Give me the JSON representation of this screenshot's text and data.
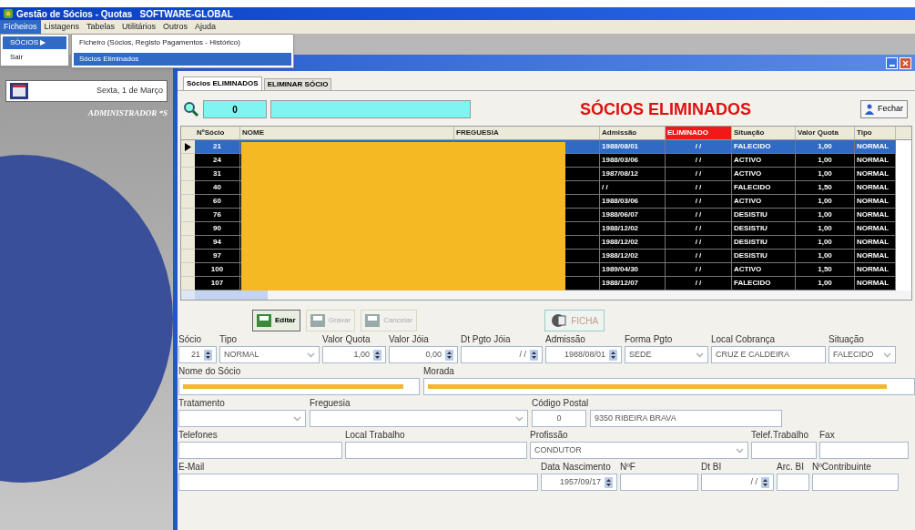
{
  "app": {
    "title": "Gestão de Sócios - Quotas   SOFTWARE-GLOBAL"
  },
  "menu_bar": [
    {
      "label": "Ficheiros",
      "selected": true
    },
    {
      "label": "Listagens",
      "selected": false
    },
    {
      "label": "Tabelas",
      "selected": false
    },
    {
      "label": "Utilitários",
      "selected": false
    },
    {
      "label": "Outros",
      "selected": false
    },
    {
      "label": "Ajuda",
      "selected": false
    }
  ],
  "open_menu": {
    "items": [
      {
        "label": "SÓCIOS",
        "arrow": "▶",
        "selected": true
      },
      {
        "label": "Sair",
        "selected": false
      }
    ],
    "submenu": [
      {
        "label": "Ficheiro (Sócios, Registo Pagamentos - Histórico)",
        "selected": false
      },
      {
        "label": "Sócios Eliminados",
        "selected": true
      }
    ]
  },
  "side_panel": {
    "date": "Sexta, 1 de Março",
    "user": "ADMINISTRADOR *S"
  },
  "form_window": {
    "tabs": [
      {
        "label": "Sócios ELIMINADOS",
        "selected": true
      },
      {
        "label": "ELIMINAR SÓCIO",
        "selected": false
      }
    ],
    "search": {
      "value": "0"
    },
    "heading": "SÓCIOS ELIMINADOS",
    "close_button": "Fechar",
    "table": {
      "columns": [
        {
          "label": "NºSócio",
          "highlight": false
        },
        {
          "label": "NOME",
          "highlight": false
        },
        {
          "label": "FREGUESIA",
          "highlight": false
        },
        {
          "label": "Admissão",
          "highlight": false
        },
        {
          "label": "ELIMINADO",
          "highlight": true
        },
        {
          "label": "Situação",
          "highlight": false
        },
        {
          "label": "Valor Quota",
          "highlight": false
        },
        {
          "label": "Tipo",
          "highlight": false
        }
      ],
      "rows": [
        {
          "number": "21",
          "admission": "1988/08/01",
          "eliminated": "/ /",
          "situation": "FALECIDO",
          "quota": "1,00",
          "type": "NORMAL",
          "selected": true
        },
        {
          "number": "24",
          "admission": "1988/03/06",
          "eliminated": "/ /",
          "situation": "ACTIVO",
          "quota": "1,00",
          "type": "NORMAL",
          "selected": false
        },
        {
          "number": "31",
          "admission": "1987/08/12",
          "eliminated": "/ /",
          "situation": "ACTIVO",
          "quota": "1,00",
          "type": "NORMAL",
          "selected": false
        },
        {
          "number": "40",
          "admission": "/ /",
          "eliminated": "/ /",
          "situation": "FALECIDO",
          "quota": "1,50",
          "type": "NORMAL",
          "selected": false
        },
        {
          "number": "60",
          "admission": "1988/03/06",
          "eliminated": "/ /",
          "situation": "ACTIVO",
          "quota": "1,00",
          "type": "NORMAL",
          "selected": false
        },
        {
          "number": "76",
          "admission": "1988/06/07",
          "eliminated": "/ /",
          "situation": "DESISTIU",
          "quota": "1,00",
          "type": "NORMAL",
          "selected": false
        },
        {
          "number": "90",
          "admission": "1988/12/02",
          "eliminated": "/ /",
          "situation": "DESISTIU",
          "quota": "1,00",
          "type": "NORMAL",
          "selected": false
        },
        {
          "number": "94",
          "admission": "1988/12/02",
          "eliminated": "/ /",
          "situation": "DESISTIU",
          "quota": "1,00",
          "type": "NORMAL",
          "selected": false
        },
        {
          "number": "97",
          "admission": "1988/12/02",
          "eliminated": "/ /",
          "situation": "DESISTIU",
          "quota": "1,00",
          "type": "NORMAL",
          "selected": false
        },
        {
          "number": "100",
          "admission": "1989/04/30",
          "eliminated": "/ /",
          "situation": "ACTIVO",
          "quota": "1,50",
          "type": "NORMAL",
          "selected": false
        },
        {
          "number": "107",
          "admission": "1988/12/07",
          "eliminated": "/ /",
          "situation": "FALECIDO",
          "quota": "1,00",
          "type": "NORMAL",
          "selected": false
        }
      ]
    },
    "actions": [
      {
        "label": "Editar",
        "disabled": false
      },
      {
        "label": "Gravar",
        "disabled": true
      },
      {
        "label": "Cancelar",
        "disabled": true
      }
    ],
    "ficha_button": "FICHA",
    "field_rows": [
      [
        {
          "label": "Sócio",
          "kind": "spin",
          "value": "21"
        },
        {
          "label": "Tipo",
          "kind": "select",
          "value": "NORMAL"
        },
        {
          "label": "Valor Quota",
          "kind": "spin",
          "value": "1,00"
        },
        {
          "label": "Valor Jóia",
          "kind": "spin",
          "value": "0,00"
        },
        {
          "label": "Dt Pgto Jóia",
          "kind": "spin",
          "value": "/ /"
        },
        {
          "label": "Admissão",
          "kind": "spin",
          "value": "1988/08/01"
        },
        {
          "label": "Forma Pgto",
          "kind": "select",
          "value": "SEDE"
        },
        {
          "label": "Local Cobrança",
          "kind": "text",
          "value": "CRUZ E CALDEIRA"
        },
        {
          "label": "Situação",
          "kind": "select",
          "value": "FALECIDO"
        }
      ],
      [
        {
          "label": "Nome do Sócio",
          "kind": "redacted"
        },
        {
          "label": "Morada",
          "kind": "redacted"
        }
      ],
      [
        {
          "label": "Tratamento",
          "kind": "select"
        },
        {
          "label": "Freguesia",
          "kind": "select"
        },
        {
          "label": "Código Postal",
          "kind": "postal",
          "values": [
            "0",
            "9350 RIBEIRA BRAVA"
          ]
        }
      ],
      [
        {
          "label": "Telefones",
          "kind": "text"
        },
        {
          "label": "Local Trabalho",
          "kind": "text"
        },
        {
          "label": "Profissão",
          "kind": "select",
          "value": "CONDUTOR"
        },
        {
          "label": "Telef.Trabalho",
          "kind": "text"
        },
        {
          "label": "Fax",
          "kind": "text"
        }
      ],
      [
        {
          "label": "E-Mail",
          "kind": "text"
        },
        {
          "label": "Data Nascimento",
          "kind": "spin",
          "value": "1957/09/17"
        },
        {
          "label": "NºF",
          "kind": "text"
        },
        {
          "label": "Dt BI",
          "kind": "spin",
          "value": "/ /"
        },
        {
          "label": "Arc. BI",
          "kind": "text"
        },
        {
          "label": "NºContribuinte",
          "kind": "text"
        }
      ]
    ]
  }
}
